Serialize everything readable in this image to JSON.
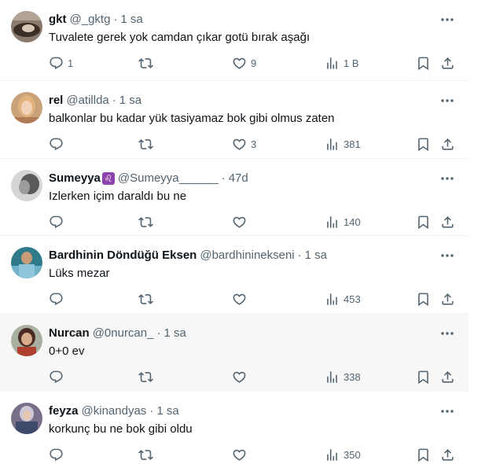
{
  "tweets": [
    {
      "name": "gkt",
      "sign": "",
      "handle": "@_gktg",
      "time": "1 sa",
      "text": "Tuvalete gerek yok camdan çıkar gotü bırak aşağı",
      "replies": "1",
      "retweets": "",
      "likes": "9",
      "views": "1 B"
    },
    {
      "name": "rel",
      "sign": "",
      "handle": "@atillda",
      "time": "1 sa",
      "text": "balkonlar bu kadar yük tasiyamaz bok gibi olmus zaten",
      "replies": "",
      "retweets": "",
      "likes": "3",
      "views": "381"
    },
    {
      "name": "Sumeyya",
      "sign": "♌",
      "handle": "@Sumeyya______",
      "time": "47d",
      "text": "Izlerken içim daraldı bu ne",
      "replies": "",
      "retweets": "",
      "likes": "",
      "views": "140"
    },
    {
      "name": "Bardhinin Döndüğü Eksen",
      "sign": "",
      "handle": "@bardhininekseni",
      "time": "1 sa",
      "text": "Lüks mezar",
      "replies": "",
      "retweets": "",
      "likes": "",
      "views": "453"
    },
    {
      "name": "Nurcan",
      "sign": "",
      "handle": "@0nurcan_",
      "time": "1 sa",
      "text": "0+0 ev",
      "replies": "",
      "retweets": "",
      "likes": "",
      "views": "338"
    },
    {
      "name": "feyza",
      "sign": "",
      "handle": "@kinandyas",
      "time": "1 sa",
      "text": "korkunç bu ne bok gibi oldu",
      "replies": "",
      "retweets": "",
      "likes": "",
      "views": "350"
    }
  ],
  "icons": {
    "more": "more-dots-icon",
    "reply": "reply-icon",
    "retweet": "retweet-icon",
    "like": "heart-icon",
    "views": "views-icon",
    "bookmark": "bookmark-icon",
    "share": "share-icon"
  },
  "colors": {
    "text": "#0f1419",
    "secondary": "#536471",
    "border": "#eff3f4",
    "highlight_row": "#f7f7f7",
    "zodiac_badge": "#8e44ad"
  }
}
